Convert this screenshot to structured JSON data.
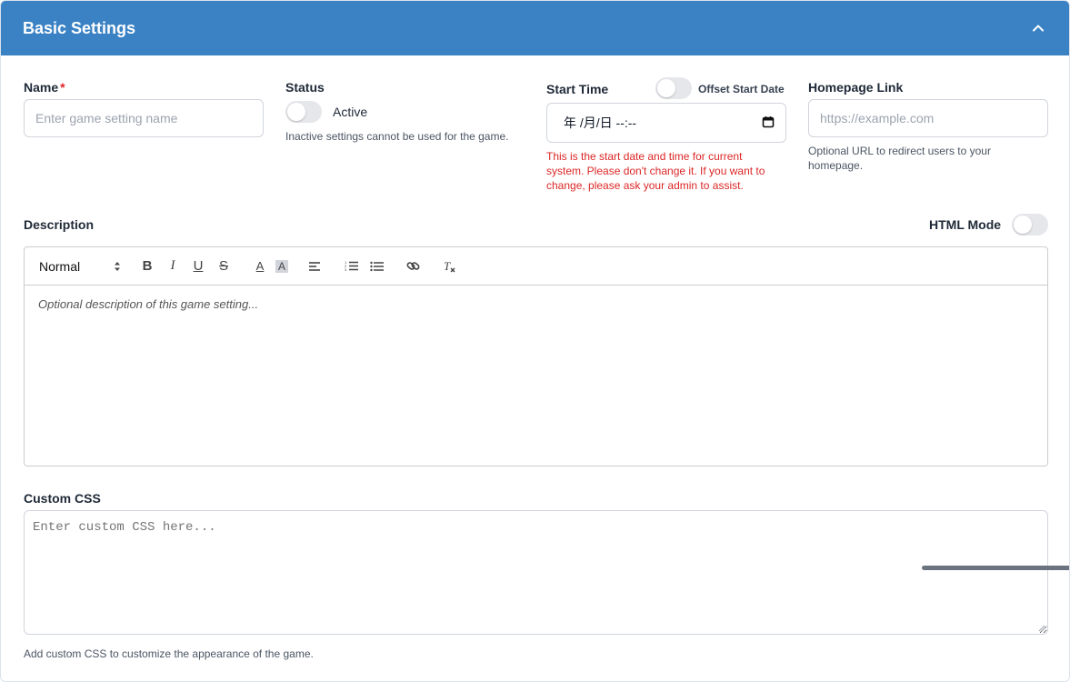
{
  "header": {
    "title": "Basic Settings",
    "collapse_icon": "chevron-up-icon"
  },
  "name": {
    "label": "Name",
    "required_mark": "*",
    "placeholder": "Enter game setting name"
  },
  "status": {
    "label": "Status",
    "toggle_label": "Active",
    "toggle_on": false,
    "help": "Inactive settings cannot be used for the game."
  },
  "start_time": {
    "label": "Start Time",
    "offset_toggle_label": "Offset Start Date",
    "offset_toggle_on": false,
    "value": "年 /月/日 --:--",
    "calendar_icon": "calendar-icon",
    "warning_lines": [
      "This is the start date and time for current",
      "system. Please don't change it. If you want to",
      "change, please ask your admin to assist."
    ]
  },
  "homepage": {
    "label": "Homepage Link",
    "placeholder": "https://example.com",
    "help_lines": [
      "Optional URL to redirect users to your",
      "homepage."
    ]
  },
  "description": {
    "label": "Description",
    "html_mode_label": "HTML Mode",
    "html_mode_on": false,
    "toolbar": {
      "format_select": "Normal",
      "bold": "B",
      "italic": "I",
      "underline": "U",
      "strike": "S",
      "color": "A",
      "background": "A"
    },
    "placeholder": "Optional description of this game setting..."
  },
  "custom_css": {
    "label": "Custom CSS",
    "placeholder": "Enter custom CSS here...",
    "help": "Add custom CSS to customize the appearance of the game."
  },
  "colors": {
    "header_bg": "#3a82c4",
    "error": "#dc2626",
    "toggle_off": "#e5e7eb"
  }
}
